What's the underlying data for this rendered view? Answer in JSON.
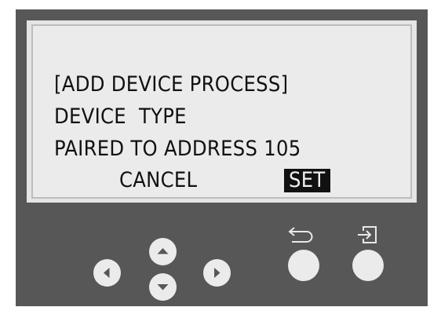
{
  "screen": {
    "title_line": "[ADD DEVICE PROCESS]",
    "type_line": "DEVICE  TYPE",
    "address_line": "PAIRED TO ADDRESS 105",
    "cancel_label": "CANCEL",
    "set_label": "SET"
  },
  "controls": {
    "left": "left-arrow",
    "up": "up-arrow",
    "down": "down-arrow",
    "right": "right-arrow",
    "back": "back-icon",
    "enter": "enter-icon"
  },
  "colors": {
    "housing": "#575757",
    "lcd_background": "#ebebeb",
    "text": "#111111",
    "selected_bg": "#111111"
  }
}
